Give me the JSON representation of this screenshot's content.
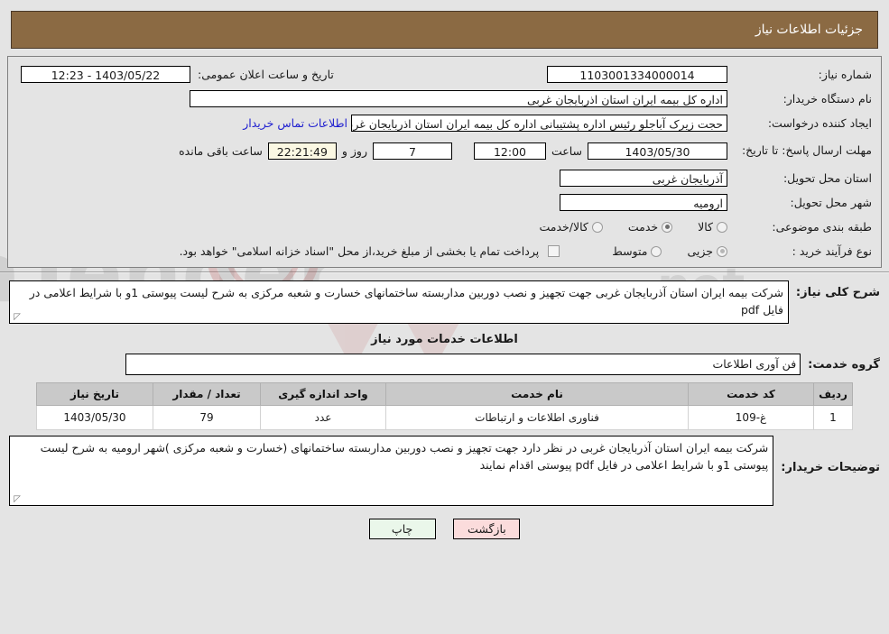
{
  "header": {
    "title": "جزئیات اطلاعات نیاز"
  },
  "form": {
    "need_number_label": "شماره نیاز:",
    "need_number_value": "1103001334000014",
    "announce_datetime_label": "تاریخ و ساعت اعلان عمومی:",
    "announce_datetime_value": "1403/05/22 - 12:23",
    "buyer_org_label": "نام دستگاه خریدار:",
    "buyer_org_value": "اداره کل بیمه ایران استان اذربایجان غربی",
    "requester_label": "ایجاد کننده درخواست:",
    "requester_value": "حجت زیرک آباجلو رئیس اداره پشتیبانی اداره کل بیمه ایران استان اذربایجان غربی",
    "contact_link": "اطلاعات تماس خریدار",
    "deadline_label": "مهلت ارسال پاسخ: تا تاریخ:",
    "deadline_date": "1403/05/30",
    "hour_label": "ساعت",
    "hour_value": "12:00",
    "days_value": "7",
    "days_label": "روز و",
    "countdown_value": "22:21:49",
    "remaining_label": "ساعت باقی مانده",
    "province_label": "استان محل تحویل:",
    "province_value": "آذربایجان غربی",
    "city_label": "شهر محل تحویل:",
    "city_value": "ارومیه",
    "category_label": "طبقه بندی موضوعی:",
    "category_options": [
      {
        "label": "کالا",
        "selected": false
      },
      {
        "label": "خدمت",
        "selected": true
      },
      {
        "label": "کالا/خدمت",
        "selected": false
      }
    ],
    "process_label": "نوع فرآیند خرید :",
    "process_options": [
      {
        "label": "جزیی",
        "selected": true
      },
      {
        "label": "متوسط",
        "selected": false
      }
    ],
    "treasury_checkbox_checked": false,
    "treasury_text": "پرداخت تمام یا بخشی از مبلغ خرید،از محل \"اسناد خزانه اسلامی\" خواهد بود."
  },
  "summary": {
    "label": "شرح کلی نیاز:",
    "text": "شرکت بیمه ایران استان آذربایجان غربی جهت تجهیز و نصب دوربین مداربسته ساختمانهای خسارت و شعبه مرکزی  به شرح لیست پیوستی 1و با شرایط اعلامی در فایل pdf"
  },
  "services_section": {
    "title": "اطلاعات خدمات مورد نیاز",
    "group_label": "گروه خدمت:",
    "group_value": "فن آوری اطلاعات"
  },
  "table": {
    "columns": [
      "ردیف",
      "کد خدمت",
      "نام خدمت",
      "واحد اندازه گیری",
      "تعداد / مقدار",
      "تاریخ نیاز"
    ],
    "rows": [
      {
        "index": "1",
        "code": "غ-109",
        "name": "فناوری اطلاعات و ارتباطات",
        "unit": "عدد",
        "quantity": "79",
        "date": "1403/05/30"
      }
    ]
  },
  "buyer_notes": {
    "label": "توضیحات خریدار:",
    "text": "شرکت بیمه ایران استان آذربایجان غربی در نظر دارد جهت تجهیز و نصب دوربین مداربسته ساختمانهای (خسارت و شعبه مرکزی )شهر ارومیه به شرح لیست پیوستی 1و با شرایط اعلامی در فایل pdf پیوستی اقدام نمایند"
  },
  "buttons": {
    "print": "چاپ",
    "back": "بازگشت"
  },
  "colors": {
    "header_bg": "#8b6a43",
    "page_bg": "#e4e4e4",
    "link": "#2020d0",
    "table_header_bg": "#c9c9c9",
    "countdown_bg": "#fbf8e3",
    "print_btn_bg": "#eaf7ea",
    "back_btn_bg": "#fbdcdc"
  },
  "watermark": {
    "text": "AriaTender.net"
  }
}
